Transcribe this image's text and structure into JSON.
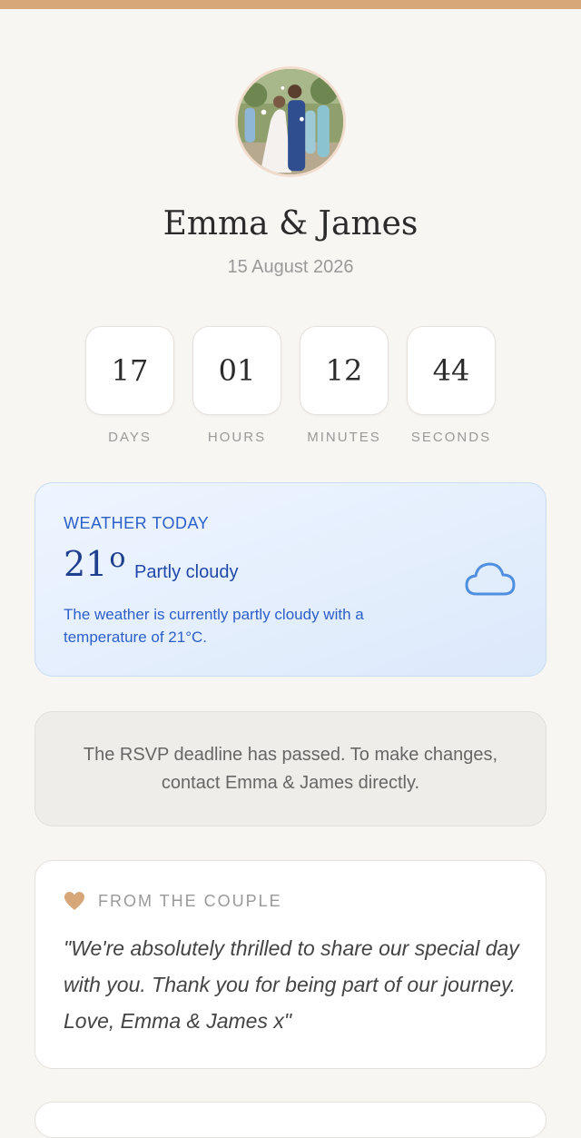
{
  "header": {
    "couple_names": "Emma & James",
    "wedding_date": "15 August 2026"
  },
  "countdown": [
    {
      "value": "17",
      "label": "DAYS"
    },
    {
      "value": "01",
      "label": "HOURS"
    },
    {
      "value": "12",
      "label": "MINUTES"
    },
    {
      "value": "44",
      "label": "SECONDS"
    }
  ],
  "weather": {
    "title": "WEATHER TODAY",
    "temperature": "21",
    "degree_symbol": "o",
    "condition": "Partly cloudy",
    "description": "The weather is currently partly cloudy with a temperature of 21°C.",
    "icon": "cloud-icon"
  },
  "rsvp": {
    "message": "The RSVP deadline has passed. To make changes, contact Emma & James directly."
  },
  "couple_note": {
    "heading": "FROM THE COUPLE",
    "icon": "heart-icon",
    "message": "\"We're absolutely thrilled to share our special day with you. Thank you for being part of our journey. Love, Emma & James x\""
  },
  "colors": {
    "accent": "#d7a679",
    "weather_blue": "#2b5fc9",
    "background": "#f8f6f3"
  }
}
